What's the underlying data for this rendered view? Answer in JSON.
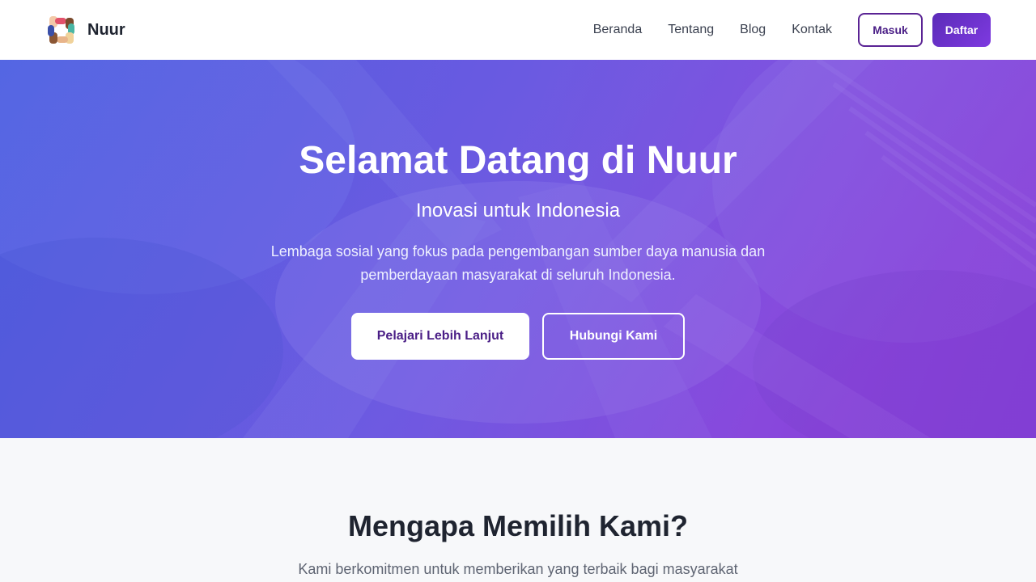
{
  "header": {
    "brand_name": "Nuur",
    "nav": [
      {
        "label": "Beranda"
      },
      {
        "label": "Tentang"
      },
      {
        "label": "Blog"
      },
      {
        "label": "Kontak"
      }
    ],
    "login_label": "Masuk",
    "register_label": "Daftar"
  },
  "hero": {
    "title": "Selamat Datang di Nuur",
    "subtitle": "Inovasi untuk Indonesia",
    "description": "Lembaga sosial yang fokus pada pengembangan sumber daya manusia dan pemberdayaan masyarakat di seluruh Indonesia.",
    "primary_cta": "Pelajari Lebih Lanjut",
    "secondary_cta": "Hubungi Kami",
    "background_image": "hands-stacked-together-photo"
  },
  "features": {
    "title": "Mengapa Memilih Kami?",
    "description": "Kami berkomitmen untuk memberikan yang terbaik bagi masyarakat"
  },
  "colors": {
    "accent": "#5a2394",
    "gradient_start": "#4f5fe0",
    "gradient_end": "#7f3cd4",
    "section_bg": "#f7f8fa"
  }
}
